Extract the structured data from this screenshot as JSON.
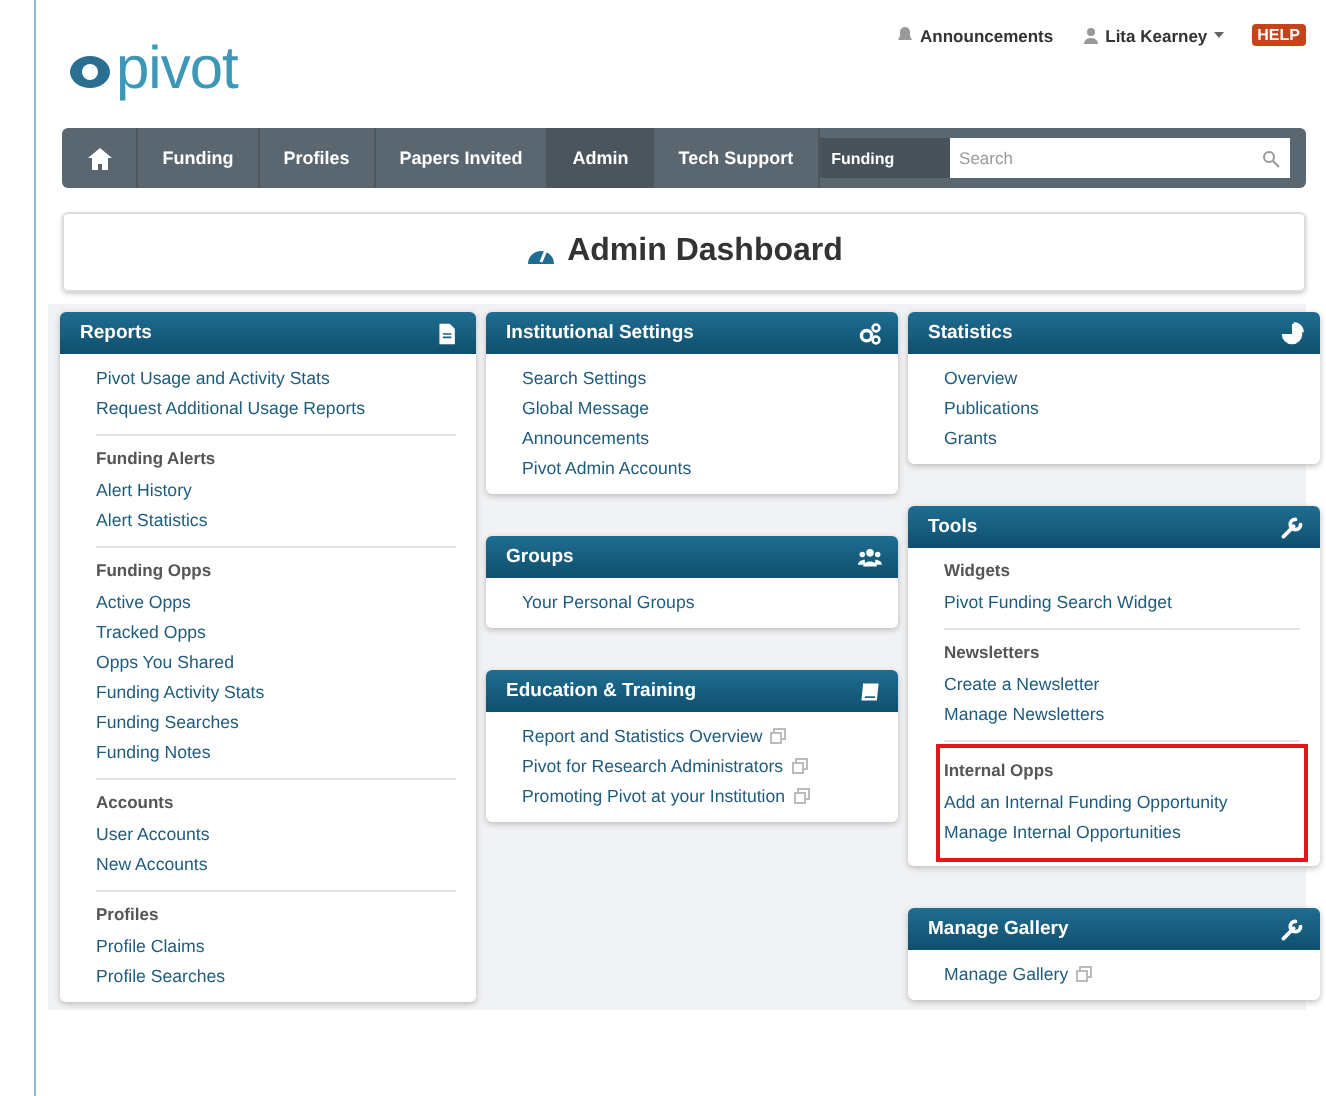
{
  "header": {
    "logo": "pivot",
    "announcements": "Announcements",
    "user": "Lita Kearney",
    "help": "HELP"
  },
  "nav": {
    "items": [
      {
        "label": "Funding",
        "selected": false
      },
      {
        "label": "Profiles",
        "selected": false
      },
      {
        "label": "Papers Invited",
        "selected": false
      },
      {
        "label": "Admin",
        "selected": true
      },
      {
        "label": "Tech Support",
        "selected": false
      }
    ],
    "search_scope": "Funding",
    "search": {
      "placeholder": "Search"
    }
  },
  "page_title": "Admin Dashboard",
  "columns": [
    {
      "panels": [
        {
          "title": "Reports",
          "sections": [
            {
              "highlighted": false,
              "links": [
                {
                  "label": "Pivot Usage and Activity Stats",
                  "external": false
                },
                {
                  "label": "Request Additional Usage Reports",
                  "external": false
                }
              ]
            },
            {
              "heading": "Funding Alerts",
              "highlighted": false,
              "links": [
                {
                  "label": "Alert History",
                  "external": false
                },
                {
                  "label": "Alert Statistics",
                  "external": false
                }
              ]
            },
            {
              "heading": "Funding Opps",
              "highlighted": false,
              "links": [
                {
                  "label": "Active Opps",
                  "external": false
                },
                {
                  "label": "Tracked Opps",
                  "external": false
                },
                {
                  "label": "Opps You Shared",
                  "external": false
                },
                {
                  "label": "Funding Activity Stats",
                  "external": false
                },
                {
                  "label": "Funding Searches",
                  "external": false
                },
                {
                  "label": "Funding Notes",
                  "external": false
                }
              ]
            },
            {
              "heading": "Accounts",
              "highlighted": false,
              "links": [
                {
                  "label": "User Accounts",
                  "external": false
                },
                {
                  "label": "New Accounts",
                  "external": false
                }
              ]
            },
            {
              "heading": "Profiles",
              "highlighted": false,
              "links": [
                {
                  "label": "Profile Claims",
                  "external": false
                },
                {
                  "label": "Profile Searches",
                  "external": false
                }
              ]
            }
          ]
        }
      ]
    },
    {
      "panels": [
        {
          "title": "Institutional Settings",
          "sections": [
            {
              "highlighted": false,
              "links": [
                {
                  "label": "Search Settings",
                  "external": false
                },
                {
                  "label": "Global Message",
                  "external": false
                },
                {
                  "label": "Announcements",
                  "external": false
                },
                {
                  "label": "Pivot Admin Accounts",
                  "external": false
                }
              ]
            }
          ]
        },
        {
          "title": "Groups",
          "sections": [
            {
              "highlighted": false,
              "links": [
                {
                  "label": "Your Personal Groups",
                  "external": false
                }
              ]
            }
          ]
        },
        {
          "title": "Education & Training",
          "sections": [
            {
              "highlighted": false,
              "links": [
                {
                  "label": "Report and Statistics Overview",
                  "external": true
                },
                {
                  "label": "Pivot for Research Administrators",
                  "external": true
                },
                {
                  "label": "Promoting Pivot at your Institution",
                  "external": true
                }
              ]
            }
          ]
        }
      ]
    },
    {
      "panels": [
        {
          "title": "Statistics",
          "sections": [
            {
              "highlighted": false,
              "links": [
                {
                  "label": "Overview",
                  "external": false
                },
                {
                  "label": "Publications",
                  "external": false
                },
                {
                  "label": "Grants",
                  "external": false
                }
              ]
            }
          ]
        },
        {
          "title": "Tools",
          "sections": [
            {
              "heading": "Widgets",
              "highlighted": false,
              "links": [
                {
                  "label": "Pivot Funding Search Widget",
                  "external": false
                }
              ]
            },
            {
              "heading": "Newsletters",
              "highlighted": false,
              "links": [
                {
                  "label": "Create a Newsletter",
                  "external": false
                },
                {
                  "label": "Manage Newsletters",
                  "external": false
                }
              ]
            },
            {
              "heading": "Internal Opps",
              "highlighted": true,
              "links": [
                {
                  "label": "Add an Internal Funding Opportunity",
                  "external": false
                },
                {
                  "label": "Manage Internal Opportunities",
                  "external": false
                }
              ]
            }
          ]
        },
        {
          "title": "Manage Gallery",
          "sections": [
            {
              "highlighted": false,
              "links": [
                {
                  "label": "Manage Gallery",
                  "external": true
                }
              ]
            }
          ]
        }
      ]
    }
  ]
}
